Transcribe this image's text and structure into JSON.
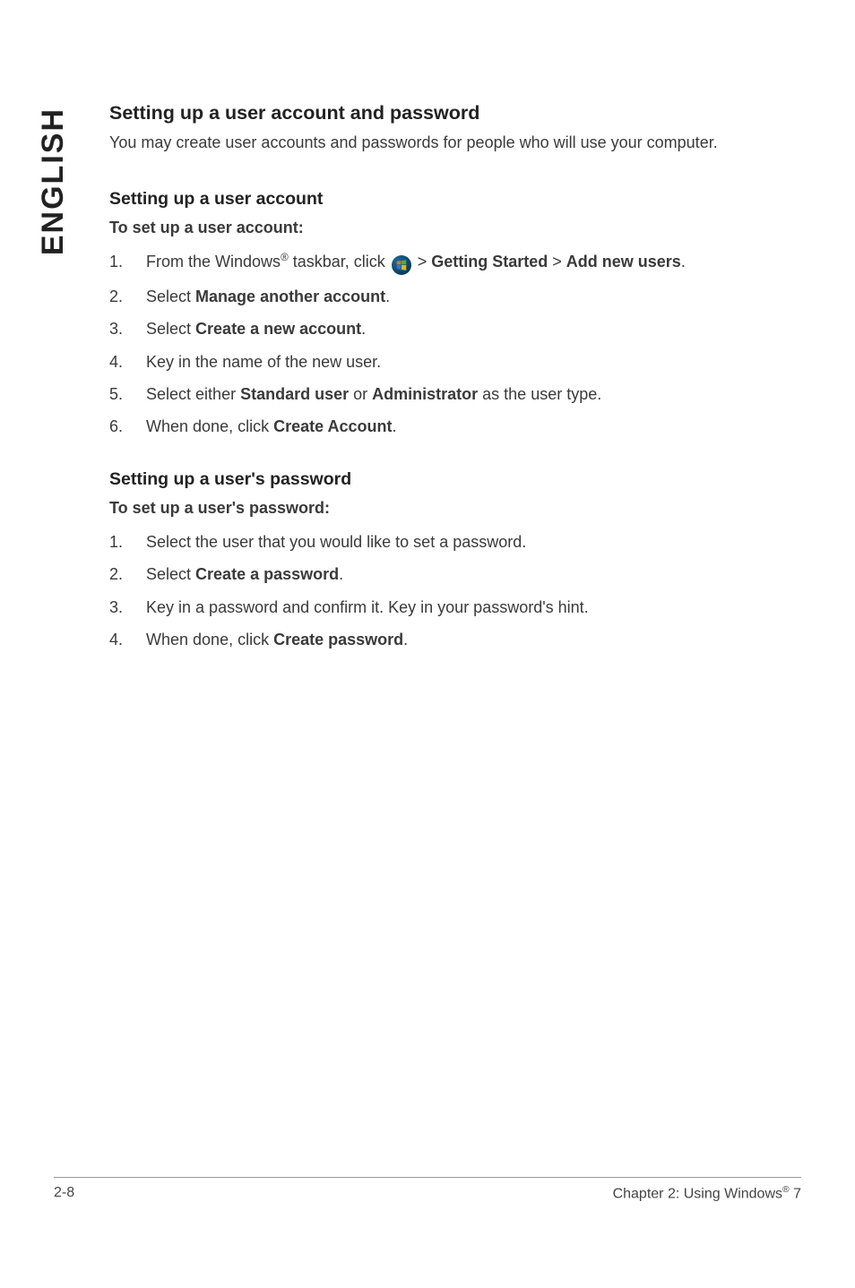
{
  "side_label": "ENGLISH",
  "title": "Setting up a user account and password",
  "intro": "You may create user accounts and passwords for people who will use your computer.",
  "section_account": {
    "heading": "Setting up a user account",
    "subheading": "To set up a user account:",
    "items": {
      "one": {
        "prefix": "From the Windows",
        "sup": "®",
        "mid": " taskbar, click ",
        "after_icon": " > ",
        "b1": "Getting Started",
        "sep": " > ",
        "b2": "Add new users",
        "end": "."
      },
      "two": {
        "prefix": "Select ",
        "bold": "Manage another account",
        "end": "."
      },
      "three": {
        "prefix": "Select ",
        "bold": "Create a new account",
        "end": "."
      },
      "four": {
        "text": "Key in the name of the new user."
      },
      "five": {
        "prefix": "Select either ",
        "b1": "Standard user",
        "mid": " or ",
        "b2": "Administrator",
        "end": " as the user type."
      },
      "six": {
        "prefix": "When done, click ",
        "bold": "Create Account",
        "end": "."
      }
    },
    "nums": {
      "one": "1.",
      "two": "2.",
      "three": "3.",
      "four": "4.",
      "five": "5.",
      "six": "6."
    }
  },
  "section_password": {
    "heading": "Setting up a user's password",
    "subheading": "To set up a user's password:",
    "items": {
      "one": {
        "text": "Select the user that you would like to set a password."
      },
      "two": {
        "prefix": "Select ",
        "bold": "Create a password",
        "end": "."
      },
      "three": {
        "text": "Key in a password and confirm it. Key in your password's hint."
      },
      "four": {
        "prefix": "When done, click ",
        "bold": "Create password",
        "end": "."
      }
    },
    "nums": {
      "one": "1.",
      "two": "2.",
      "three": "3.",
      "four": "4."
    }
  },
  "footer": {
    "left": "2-8",
    "right_prefix": "Chapter 2: Using Windows",
    "right_sup": "®",
    "right_suffix": " 7"
  }
}
